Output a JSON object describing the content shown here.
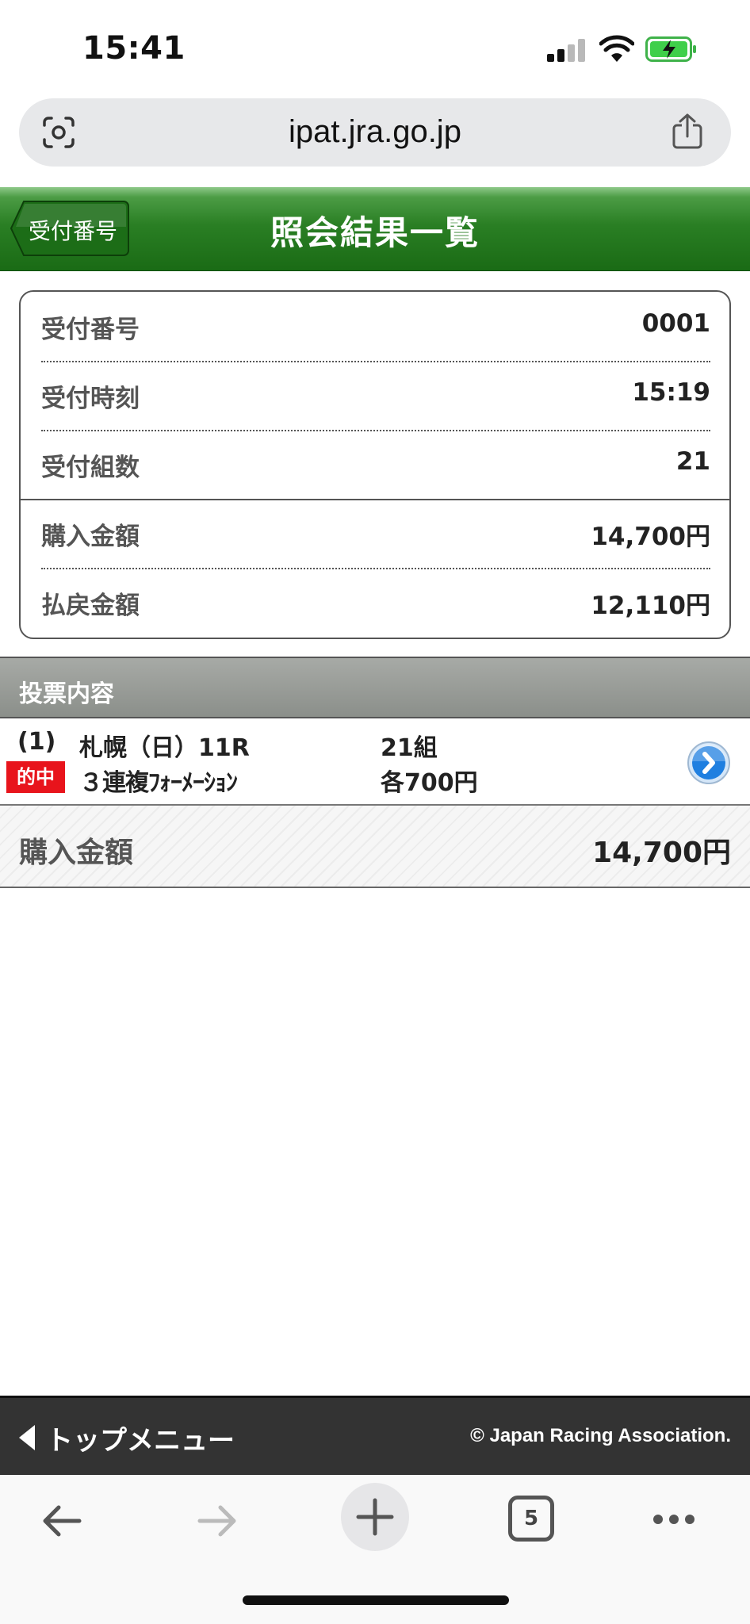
{
  "status_bar": {
    "time": "15:41"
  },
  "browser": {
    "url": "ipat.jra.go.jp",
    "tab_count": "5"
  },
  "header": {
    "back_label": "受付番号",
    "title": "照会結果一覧"
  },
  "summary": {
    "rows": [
      {
        "label": "受付番号",
        "value": "0001"
      },
      {
        "label": "受付時刻",
        "value": "15:19"
      },
      {
        "label": "受付組数",
        "value": "21"
      },
      {
        "label": "購入金額",
        "value": "14,700円"
      },
      {
        "label": "払戻金額",
        "value": "12,110円"
      }
    ]
  },
  "vote_section": {
    "title": "投票内容",
    "items": [
      {
        "index": "(1)",
        "race": "札幌（日）11R",
        "combos": "21組",
        "badge": "的中",
        "bet_type": "３連複ﾌｫｰﾒｰｼｮﾝ",
        "amount_each": "各700円"
      }
    ]
  },
  "total": {
    "label": "購入金額",
    "value": "14,700円"
  },
  "footer": {
    "menu_label": "トップメニュー",
    "copyright": "© Japan Racing Association."
  },
  "colors": {
    "header_green": "#2a7f24",
    "hit_badge": "#e8141c",
    "next_button": "#1f7fe0"
  },
  "icons": [
    "lens-icon",
    "share-icon",
    "back-arrow-icon",
    "forward-arrow-icon",
    "plus-icon",
    "tabs-icon",
    "more-icon",
    "chevron-right-icon",
    "triangle-left-icon"
  ]
}
